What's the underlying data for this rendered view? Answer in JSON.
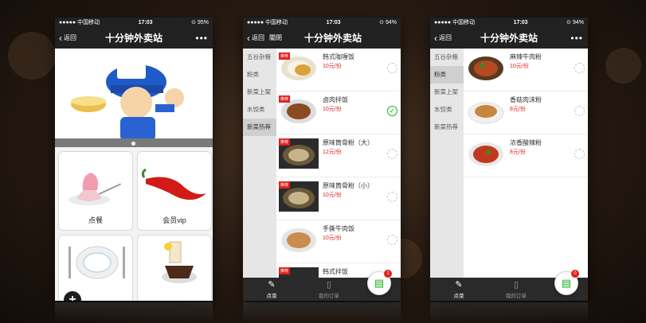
{
  "status_bar": {
    "carrier": "●●●●● 中国移动 ",
    "time": "17:03",
    "battery_left": "⊙ 95%",
    "battery_other": "⊙ 94%"
  },
  "nav": {
    "back": "返回",
    "close": "關閉",
    "title": "十分钟外卖站",
    "more": "•••"
  },
  "home": {
    "tiles": [
      {
        "label": "点餐"
      },
      {
        "label": "会员vip"
      },
      {
        "label": ""
      },
      {
        "label": ""
      }
    ]
  },
  "menu_a": {
    "categories": [
      {
        "label": "五谷杂粮"
      },
      {
        "label": "粉类"
      },
      {
        "label": "新菜上架"
      },
      {
        "label": "水饺类"
      },
      {
        "label": "新菜热荐"
      }
    ],
    "items": [
      {
        "name": "韩式咖喱饭",
        "price": "10元/份",
        "tag": "推荐",
        "checked": false
      },
      {
        "name": "卤肉拌饭",
        "price": "10元/份",
        "tag": "推荐",
        "checked": true
      },
      {
        "name": "原味筒骨粉（大）",
        "price": "12元/份",
        "tag": "推荐",
        "checked": false
      },
      {
        "name": "原味筒骨粉（小）",
        "price": "10元/份",
        "tag": "推荐",
        "checked": false
      },
      {
        "name": "手撕牛肉饭",
        "price": "10元/份",
        "tag": "",
        "checked": false
      },
      {
        "name": "韩式拌饭",
        "price": "",
        "tag": "推荐",
        "checked": false
      }
    ],
    "cart_count": "1"
  },
  "menu_b": {
    "categories": [
      {
        "label": "五谷杂粮"
      },
      {
        "label": "粉类"
      },
      {
        "label": "新菜上架"
      },
      {
        "label": "水饺类"
      },
      {
        "label": "新菜热荐"
      }
    ],
    "items": [
      {
        "name": "麻辣牛肉粉",
        "price": "10元/份"
      },
      {
        "name": "香菇肉沫粉",
        "price": "8元/份"
      },
      {
        "name": "浓香酸辣粉",
        "price": "8元/份"
      }
    ],
    "cart_count": "0"
  },
  "tabbar": {
    "order": "点菜",
    "my_orders": "我的订单"
  },
  "colors": {
    "accent_red": "#e1201b",
    "accent_green": "#1aad19",
    "bar_dark": "#212121"
  }
}
